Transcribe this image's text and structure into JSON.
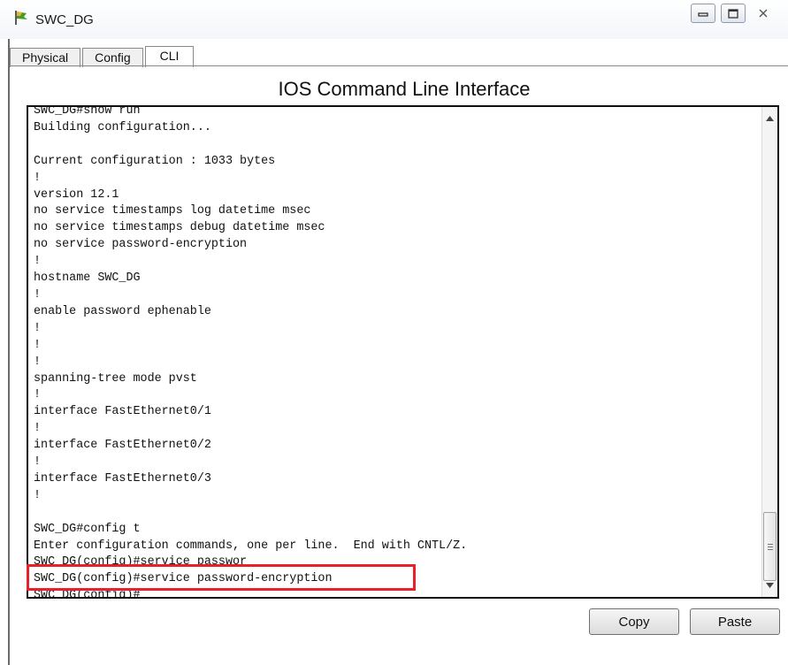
{
  "window": {
    "title": "SWC_DG",
    "icon": "packet-tracer-switch-icon",
    "controls": [
      "minimize-icon",
      "maximize-icon",
      "close-icon"
    ]
  },
  "tabs": [
    {
      "label": "Physical"
    },
    {
      "label": "Config"
    },
    {
      "label": "CLI",
      "active": true
    }
  ],
  "cli": {
    "heading": "IOS Command Line Interface",
    "lines": [
      "SWC_DG#show run",
      "Building configuration...",
      "",
      "Current configuration : 1033 bytes",
      "!",
      "version 12.1",
      "no service timestamps log datetime msec",
      "no service timestamps debug datetime msec",
      "no service password-encryption",
      "!",
      "hostname SWC_DG",
      "!",
      "enable password ephenable",
      "!",
      "!",
      "!",
      "spanning-tree mode pvst",
      "!",
      "interface FastEthernet0/1",
      "!",
      "interface FastEthernet0/2",
      "!",
      "interface FastEthernet0/3",
      "!",
      "",
      "SWC_DG#config t",
      "Enter configuration commands, one per line.  End with CNTL/Z.",
      "SWC_DG(config)#service passwor",
      "SWC_DG(config)#service password-encryption",
      "SWC_DG(config)#"
    ],
    "highlight_color": "#e8202a"
  },
  "buttons": {
    "copy": "Copy",
    "paste": "Paste"
  }
}
